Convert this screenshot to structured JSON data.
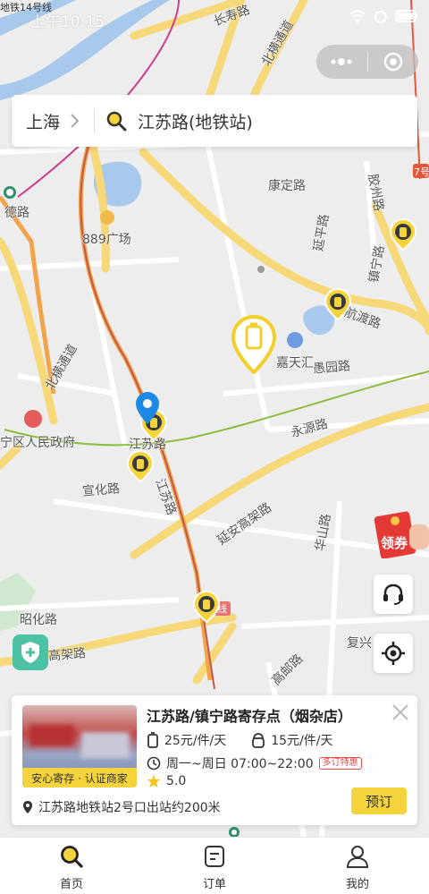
{
  "status_bar": {
    "time": "上午10:15",
    "line_label": "地铁14号线"
  },
  "search": {
    "city": "上海",
    "query": "江苏路(地铁站)"
  },
  "map": {
    "labels": {
      "changshou": "长寿路",
      "beiheng_top": "北横通道",
      "dezhe": "德路",
      "plaza": "889广场",
      "kangding": "康定路",
      "yanping": "延平路",
      "jiaozhou": "胶州路",
      "yuyuan_north": "镇宁路",
      "hangdu": "航渡路",
      "jiatianhui": "嘉天汇",
      "yuyuan": "愚园路",
      "beiheng_left": "北横通道",
      "changning_gov": "宁区人民政府",
      "jiangsu_station": "江苏路",
      "yongyuan": "永源路",
      "xuanhua": "宣化路",
      "jiangsu_road": "江苏路",
      "yanan": "延安高架路",
      "huashan": "华山路",
      "zhaohua": "昭化路",
      "gaojia": "高架路",
      "gaoyou": "高邮路",
      "fuxing": "复兴",
      "line_badge": "线",
      "line7": "7号"
    }
  },
  "coupon": {
    "label": "领券"
  },
  "card": {
    "store_name": "江苏路/镇宁路寄存点（烟杂店）",
    "badge": "安心寄存 · 认证商家",
    "big_price": "25元/件/天",
    "small_price": "15元/件/天",
    "hours": "周一~周日 07:00~22:00",
    "promo": "多订特惠",
    "rating": "5.0",
    "distance": "江苏路地铁站2号口出站约200米",
    "book_label": "预订"
  },
  "tabs": [
    {
      "label": "首页",
      "icon": "search-icon"
    },
    {
      "label": "订单",
      "icon": "order-icon"
    },
    {
      "label": "我的",
      "icon": "user-icon"
    }
  ],
  "colors": {
    "accent": "#f5d33c",
    "pin_blue": "#1e88e5",
    "shield": "#4cc1a3",
    "coupon_red": "#e53935"
  }
}
